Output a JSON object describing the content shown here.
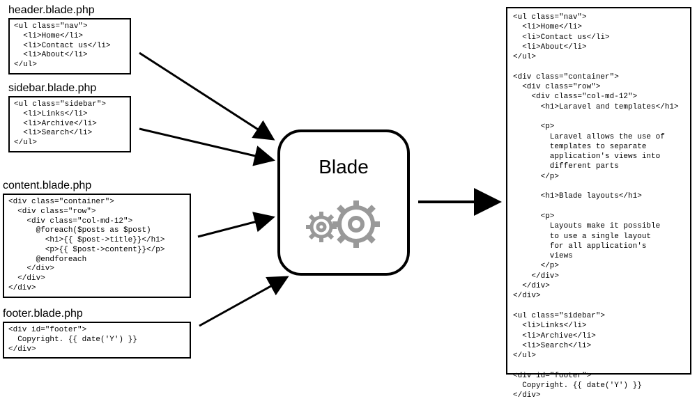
{
  "files": {
    "header": {
      "label": "header.blade.php",
      "code": "<ul class=\"nav\">\n  <li>Home</li>\n  <li>Contact us</li>\n  <li>About</li>\n</ul>"
    },
    "sidebar": {
      "label": "sidebar.blade.php",
      "code": "<ul class=\"sidebar\">\n  <li>Links</li>\n  <li>Archive</li>\n  <li>Search</li>\n</ul>"
    },
    "content": {
      "label": "content.blade.php",
      "code": "<div class=\"container\">\n  <div class=\"row\">\n    <div class=\"col-md-12\">\n      @foreach($posts as $post)\n        <h1>{{ $post->title}}</h1>\n        <p>{{ $post->content}}</p>\n      @endforeach\n    </div>\n  </div>\n</div>"
    },
    "footer": {
      "label": "footer.blade.php",
      "code": "<div id=\"footer\">\n  Copyright. {{ date('Y') }}\n</div>"
    }
  },
  "engine": {
    "title": "Blade"
  },
  "output": {
    "code": "<ul class=\"nav\">\n  <li>Home</li>\n  <li>Contact us</li>\n  <li>About</li>\n</ul>\n\n<div class=\"container\">\n  <div class=\"row\">\n    <div class=\"col-md-12\">\n      <h1>Laravel and templates</h1>\n\n      <p>\n        Laravel allows the use of\n        templates to separate\n        application's views into\n        different parts\n      </p>\n\n      <h1>Blade layouts</h1>\n\n      <p>\n        Layouts make it possible\n        to use a single layout\n        for all application's\n        views\n      </p>\n    </div>\n  </div>\n</div>\n\n<ul class=\"sidebar\">\n  <li>Links</li>\n  <li>Archive</li>\n  <li>Search</li>\n</ul>\n\n<div id=\"footer\">\n  Copyright. {{ date('Y') }}\n</div>"
  },
  "colors": {
    "gear": "#999999"
  }
}
